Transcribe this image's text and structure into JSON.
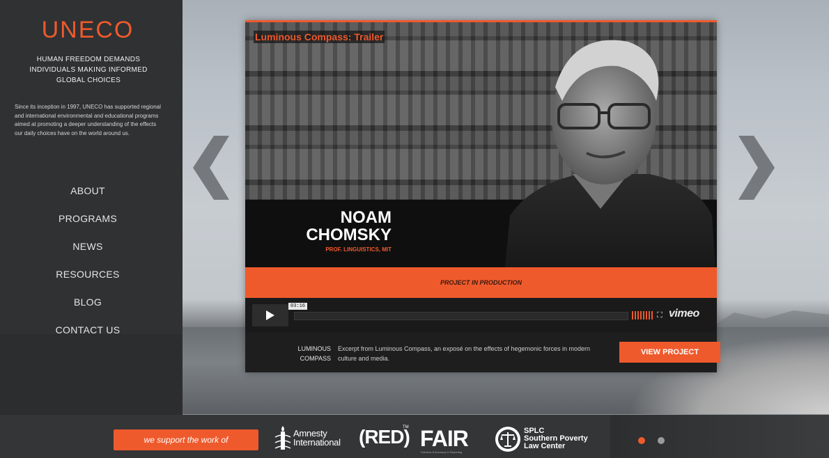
{
  "brand": {
    "logo": "UNECO",
    "tagline": [
      "HUMAN FREEDOM DEMANDS",
      "INDIVIDUALS MAKING INFORMED",
      "GLOBAL CHOICES"
    ],
    "intro": "Since its inception in 1997, UNECO has supported regional and international environmental and educational programs aimed at promoting a deeper understanding of the effects our daily choices have on the world around us."
  },
  "nav": {
    "items": [
      {
        "label": "ABOUT"
      },
      {
        "label": "PROGRAMS"
      },
      {
        "label": "NEWS"
      },
      {
        "label": "RESOURCES"
      },
      {
        "label": "BLOG"
      },
      {
        "label": "CONTACT US"
      }
    ]
  },
  "video": {
    "title": "Luminous Compass: Trailer",
    "speaker_first": "NOAM",
    "speaker_last": "CHOMSKY",
    "speaker_role": "PROF. LINGUISTICS, MIT",
    "status": "PROJECT IN PRODUCTION",
    "time": "03:16",
    "progress": 0,
    "player_brand": "vimeo",
    "fullscreen_glyph": "⛶"
  },
  "project": {
    "title_line1": "LUMINOUS",
    "title_line2": "COMPASS",
    "description": "Excerpt from Luminous Compass, an exposé on the effects of hegemonic forces in modern culture and media.",
    "cta": "VIEW PROJECT"
  },
  "footer": {
    "support_label": "we support the work of",
    "partners": {
      "amnesty_line1": "Amnesty",
      "amnesty_line2": "International",
      "red": "(RED)",
      "red_tm": "TM",
      "fair": "FAIR",
      "fair_sub": "Fairness & Accuracy in Reporting",
      "splc_line1": "SPLC",
      "splc_line2": "Southern Poverty",
      "splc_line3": "Law Center"
    },
    "active_slide": 1,
    "slide_count": 2
  },
  "colors": {
    "accent": "#ef5a2c",
    "sidebar": "#2f3133",
    "dot_inactive": "#9a9a9a"
  },
  "icons": {
    "prev": "chevron-left-icon",
    "next": "chevron-right-icon",
    "play": "play-icon",
    "fullscreen": "fullscreen-icon",
    "amnesty": "candle-barbed-wire-icon",
    "splc": "scales-of-justice-icon"
  }
}
